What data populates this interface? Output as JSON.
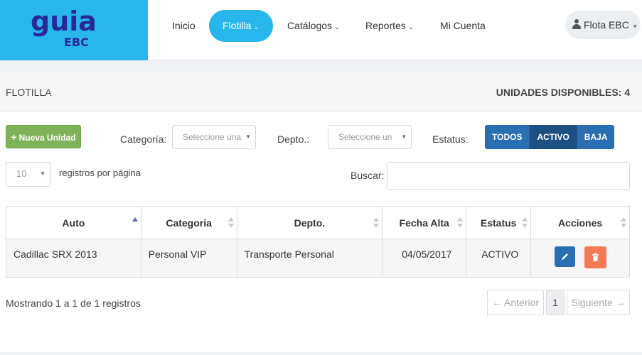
{
  "brand": {
    "line1": "guia",
    "line2": "EBC"
  },
  "nav": {
    "items": [
      {
        "label": "Inicio",
        "dropdown": false
      },
      {
        "label": "Flotilla",
        "dropdown": true,
        "active": true
      },
      {
        "label": "Catálogos",
        "dropdown": true
      },
      {
        "label": "Reportes",
        "dropdown": true
      },
      {
        "label": "Mi Cuenta",
        "dropdown": false
      }
    ],
    "user": "Flota EBC"
  },
  "panel": {
    "title": "FLOTILLA",
    "units_label": "UNIDADES DISPONIBLES: 4"
  },
  "toolbar": {
    "new_button": "Nueva Unidad",
    "categoria_label": "Categoría:",
    "categoria_placeholder": "Seleccione una",
    "depto_label": "Depto.:",
    "depto_placeholder": "Seleccione un",
    "estatus_label": "Estatus:",
    "estatus_options": [
      "TODOS",
      "ACTIVO",
      "BAJA"
    ],
    "estatus_selected": "ACTIVO",
    "page_size": "10",
    "page_size_label": "registros por página",
    "search_label": "Buscar:",
    "search_value": ""
  },
  "table": {
    "columns": [
      "Auto",
      "Categoria",
      "Depto.",
      "Fecha Alta",
      "Estatus",
      "Acciones"
    ],
    "sorted_column": "Auto",
    "rows": [
      {
        "auto": "Cadillac SRX 2013",
        "categoria": "Personal VIP",
        "depto": "Transporte Personal",
        "fecha_alta": "04/05/2017",
        "estatus": "ACTIVO"
      }
    ]
  },
  "footer": {
    "info": "Mostrando 1 a 1 de 1 registros",
    "prev": "← Anterior",
    "page": "1",
    "next": "Siguiente →"
  },
  "colors": {
    "brand_blue": "#29b6ec",
    "logo_text": "#27289a",
    "primary": "#2a6fb3",
    "success": "#7fb35a",
    "danger": "#f47a55"
  }
}
